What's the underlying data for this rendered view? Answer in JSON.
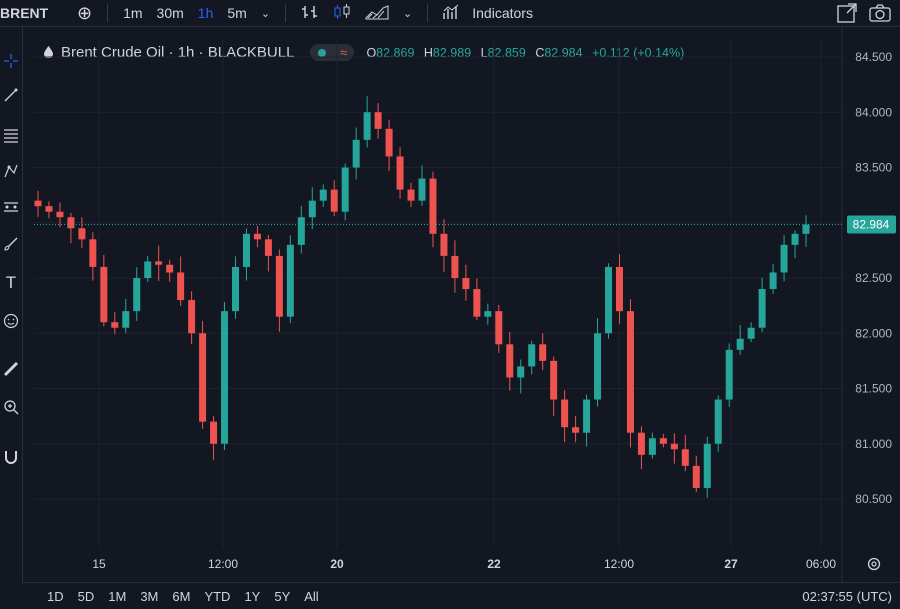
{
  "toolbar": {
    "symbol": "BRENT",
    "intervals": [
      "1m",
      "30m",
      "1h",
      "5m"
    ],
    "active_interval": "1h",
    "indicators_label": "Indicators"
  },
  "legend": {
    "title": "Brent Crude Oil · 1h · BLACKBULL",
    "o_label": "O",
    "o_value": "82.869",
    "h_label": "H",
    "h_value": "82.989",
    "l_label": "L",
    "l_value": "82.859",
    "c_label": "C",
    "c_value": "82.984",
    "change": "+0.112 (+0.14%)"
  },
  "price_badge": "82.984",
  "bottom": {
    "ranges": [
      "1D",
      "5D",
      "1M",
      "3M",
      "6M",
      "YTD",
      "1Y",
      "5Y",
      "All"
    ],
    "clock": "02:37:55 (UTC)"
  },
  "colors": {
    "up": "#26a69a",
    "down": "#ef5350",
    "badge": "#26a69a",
    "bg": "#131722",
    "grid": "#1e222d"
  },
  "chart_data": {
    "type": "candlestick",
    "title": "Brent Crude Oil · 1h · BLACKBULL",
    "y_ticks": [
      "84.500",
      "84.000",
      "83.500",
      "83.000",
      "82.500",
      "82.000",
      "81.500",
      "81.000",
      "80.500"
    ],
    "x_ticks": [
      "15",
      "12:00",
      "20",
      "22",
      "12:00",
      "27",
      "06:00"
    ],
    "ylim": [
      80.2,
      84.7
    ],
    "last_price": 82.984,
    "close": [
      83.15,
      83.1,
      83.05,
      82.95,
      82.85,
      82.6,
      82.1,
      82.05,
      82.2,
      82.5,
      82.65,
      82.62,
      82.55,
      82.3,
      82.0,
      81.2,
      81.0,
      82.2,
      82.6,
      82.9,
      82.85,
      82.7,
      82.15,
      82.8,
      83.05,
      83.2,
      83.3,
      83.1,
      83.5,
      83.75,
      84.0,
      83.85,
      83.6,
      83.3,
      83.2,
      83.4,
      82.9,
      82.7,
      82.5,
      82.4,
      82.15,
      82.2,
      81.9,
      81.6,
      81.7,
      81.9,
      81.75,
      81.4,
      81.15,
      81.1,
      81.4,
      82.0,
      82.6,
      82.2,
      81.1,
      80.9,
      81.05,
      81.0,
      80.95,
      80.8,
      80.6,
      81.0,
      81.4,
      81.85,
      81.95,
      82.05,
      82.4,
      82.55,
      82.8,
      82.9,
      82.984
    ]
  }
}
